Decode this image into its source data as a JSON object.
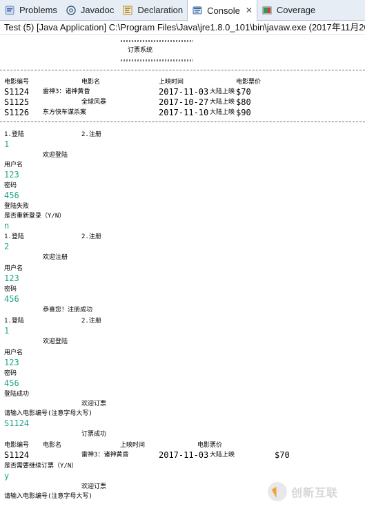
{
  "tabs": [
    {
      "label": "Problems",
      "icon": "problems-icon",
      "active": false
    },
    {
      "label": "Javadoc",
      "icon": "at-icon",
      "active": false
    },
    {
      "label": "Declaration",
      "icon": "declaration-icon",
      "active": false
    },
    {
      "label": "Console",
      "icon": "console-icon",
      "active": true,
      "close": "✕"
    },
    {
      "label": "Coverage",
      "icon": "coverage-icon",
      "active": false
    }
  ],
  "status": {
    "text": "Test (5) [Java Application] C:\\Program Files\\Java\\jre1.8.0_101\\bin\\javaw.exe (2017年11月20"
  },
  "console": {
    "title": "订票系统",
    "header_1": {
      "col1": "电影编号",
      "col2": "电影名",
      "col3": "上映时间",
      "col4": "电影票价"
    },
    "movies": [
      {
        "id": "S1124",
        "name": "雷神3：诸神黄昏",
        "date": "2017-11-03",
        "date_suffix": "大陆上映",
        "price": "$70"
      },
      {
        "id": "S1125",
        "name": "全球风暴",
        "date": "2017-10-27",
        "date_suffix": "大陆上映",
        "price": "$80"
      },
      {
        "id": "S1126",
        "name": "东方快车谋杀案",
        "date": "2017-11-10",
        "date_suffix": "大陆上映",
        "price": "$90"
      }
    ],
    "menu_login": "1.登陆",
    "menu_register": "2.注册",
    "input_1": "1",
    "welcome_login": "欢迎登陆",
    "label_username": "用户名",
    "input_username_1": "123",
    "label_password": "密码",
    "input_password_1": "456",
    "login_fail": "登陆失败",
    "relogin_prompt": "是否重新登录（Y/N）",
    "input_n": "n",
    "input_2": "2",
    "welcome_register": "欢迎注册",
    "input_username_2": "123",
    "input_password_2": "456",
    "register_success": "恭喜您！注册成功",
    "input_3": "1",
    "input_username_3": "123",
    "input_password_3": "456",
    "login_success": "登陆成功",
    "welcome_booking": "欢迎订票",
    "prompt_movie_id": "请输入电影编号(注意字母大写)",
    "input_movie_id": "S1124",
    "booking_success": "订票成功",
    "header_2": {
      "col1": "电影编号",
      "col2": "电影名",
      "col3": "上映时间",
      "col4": "电影票价"
    },
    "booked": {
      "id": "S1124",
      "name": "雷神3：诸神黄昏",
      "date": "2017-11-03",
      "date_suffix": "大陆上映",
      "price": "$70"
    },
    "continue_prompt": "是否需要继续订票（Y/N）",
    "input_y": "y",
    "welcome_booking_2": "欢迎订票",
    "prompt_movie_id_2": "请输入电影编号(注意字母大写)"
  },
  "watermark": {
    "text": "创新互联"
  }
}
